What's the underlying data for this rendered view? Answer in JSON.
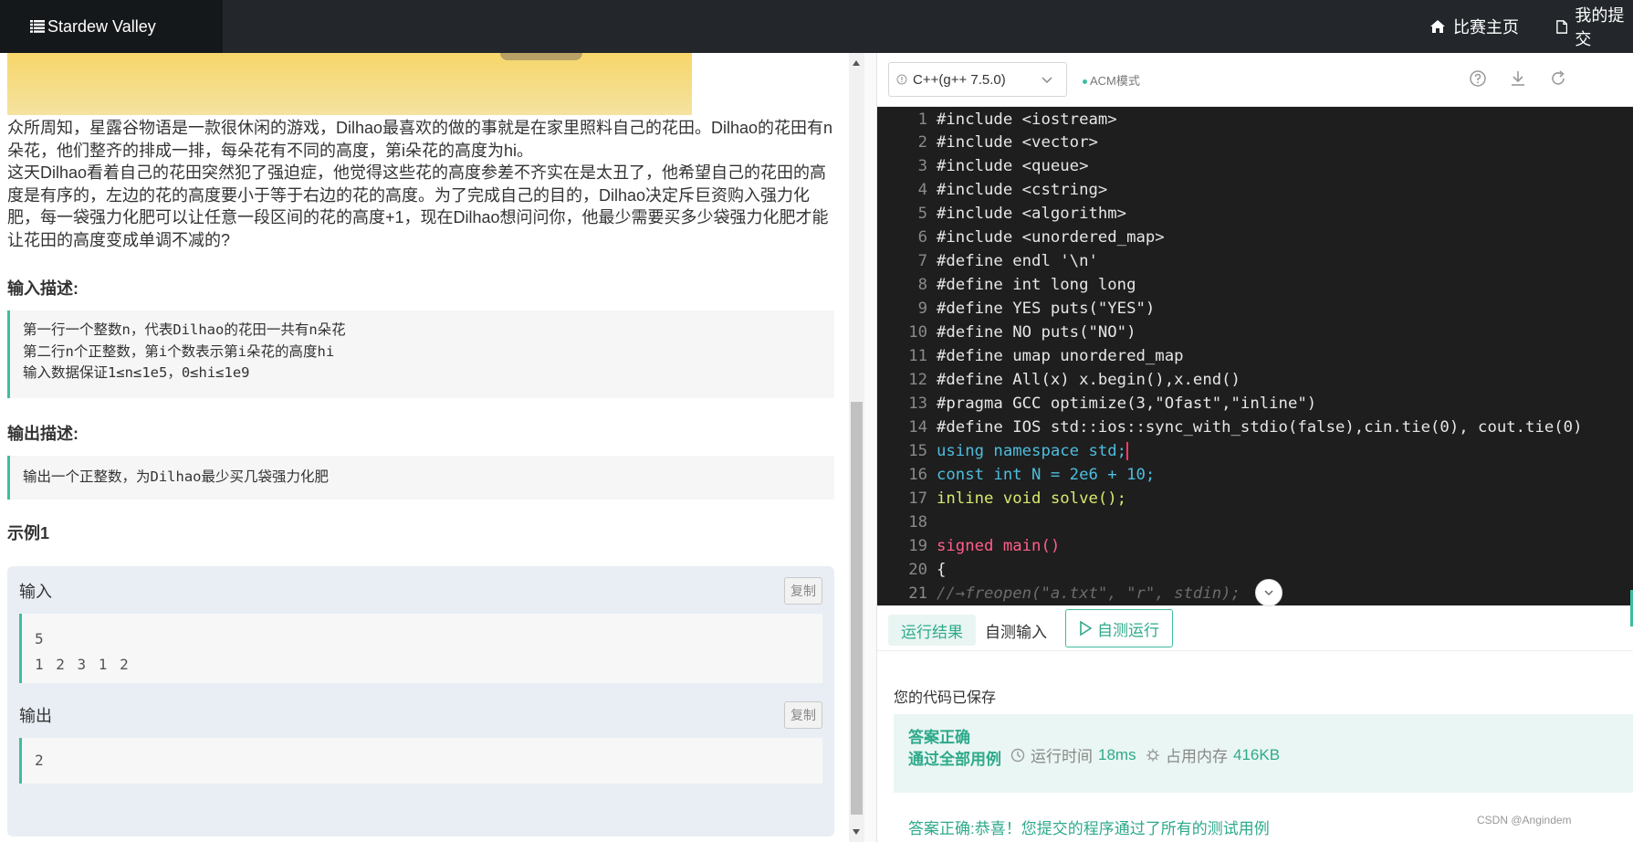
{
  "topbar": {
    "brand": "Stardew Valley",
    "nav_home": "比赛主页",
    "nav_mine": "我的提交"
  },
  "problem": {
    "description_p1": "众所周知，星露谷物语是一款很休闲的游戏，Dilhao最喜欢的做的事就是在家里照料自己的花田。Dilhao的花田有n朵花，他们整齐的排成一排，每朵花有不同的高度，第i朵花的高度为hi。",
    "description_p2": "这天Dilhao看着自己的花田突然犯了强迫症，他觉得这些花的高度参差不齐实在是太丑了，他希望自己的花田的高度是有序的，左边的花的高度要小于等于右边的花的高度。为了完成自己的目的，Dilhao决定斥巨资购入强力化肥，每一袋强力化肥可以让任意一段区间的花的高度+1，现在Dilhao想问问你，他最少需要买多少袋强力化肥才能让花田的高度变成单调不减的?",
    "input_title": "输入描述:",
    "input_lines": [
      "第一行一个整数n，代表Dilhao的花田一共有n朵花",
      "第二行n个正整数，第i个数表示第i朵花的高度hi",
      "输入数据保证1≤n≤1e5，0≤hi≤1e9"
    ],
    "output_title": "输出描述:",
    "output_line": "输出一个正整数，为Dilhao最少买几袋强力化肥",
    "example_title": "示例1",
    "example": {
      "input_label": "输入",
      "output_label": "输出",
      "copy_label": "复制",
      "input_lines": [
        "5",
        "1 2 3 1 2"
      ],
      "output_lines": [
        "2"
      ]
    }
  },
  "editor": {
    "language": "C++(g++ 7.5.0)",
    "mode": "ACM模式",
    "lines": [
      "#include <iostream>",
      "#include <vector>",
      "#include <queue>",
      "#include <cstring>",
      "#include <algorithm>",
      "#include <unordered_map>",
      "#define endl '\\n'",
      "#define int long long",
      "#define YES puts(\"YES\")",
      "#define NO puts(\"NO\")",
      "#define umap unordered_map",
      "#define All(x) x.begin(),x.end()",
      "#pragma GCC optimize(3,\"Ofast\",\"inline\")",
      "#define IOS std::ios::sync_with_stdio(false),cin.tie(0), cout.tie(0)",
      "using namespace std;",
      "const int N = 2e6 + 10;",
      "inline void solve();",
      "",
      "signed main()",
      "{",
      "//→freopen(\"a.txt\", \"r\", stdin);"
    ]
  },
  "results": {
    "tab_result": "运行结果",
    "tab_custom_input": "自测输入",
    "run_button": "自测运行",
    "saved_msg": "您的代码已保存",
    "verdict_line1": "答案正确",
    "verdict_line2": "通过全部用例",
    "time_label": "运行时间",
    "time_value": "18ms",
    "mem_label": "占用内存",
    "mem_value": "416KB",
    "result_message": "答案正确:恭喜！您提交的程序通过了所有的测试用例"
  },
  "watermark": "CSDN @Angindem",
  "colors": {
    "accent": "#3ebd9f",
    "topbar": "#23272b",
    "editor_bg": "#1e1e1e"
  }
}
